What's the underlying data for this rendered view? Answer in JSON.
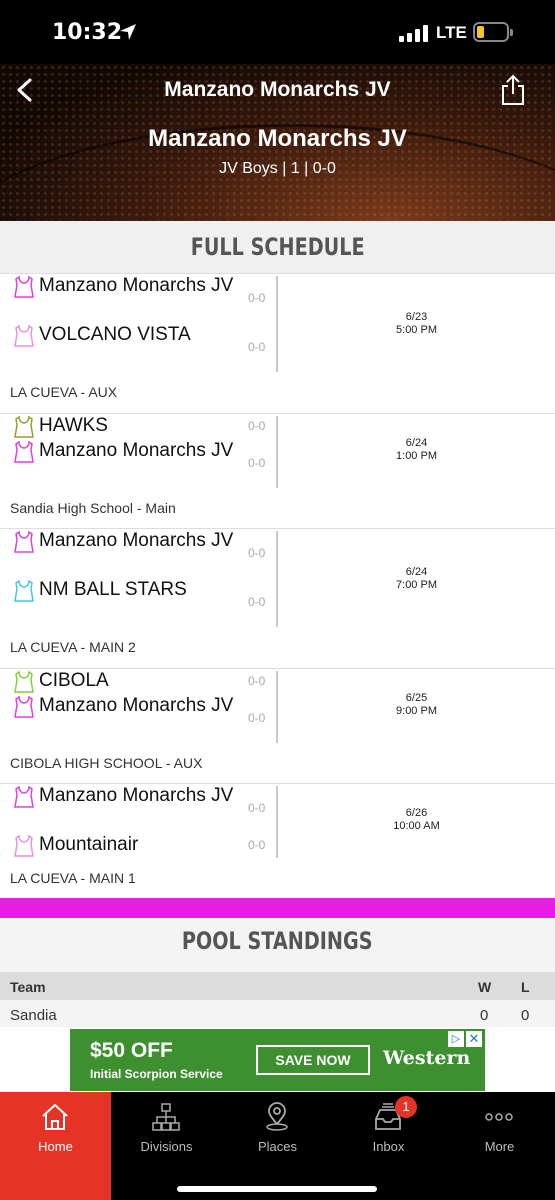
{
  "status": {
    "time": "10:32",
    "network": "LTE"
  },
  "nav": {
    "title": "Manzano Monarchs JV"
  },
  "team": {
    "name": "Manzano Monarchs JV",
    "subtitle": "JV Boys | 1 | 0-0"
  },
  "schedule": {
    "title": "FULL SCHEDULE",
    "games": [
      {
        "home": "Manzano Monarchs JV",
        "home_score": "0-0",
        "away": "VOLCANO VISTA",
        "away_score": "0-0",
        "date": "6/23",
        "time": "5:00 PM",
        "location": "LA CUEVA - AUX"
      },
      {
        "home": "HAWKS",
        "home_score": "0-0",
        "away": "Manzano Monarchs JV",
        "away_score": "0-0",
        "date": "6/24",
        "time": "1:00 PM",
        "location": "Sandia High School - Main"
      },
      {
        "home": "Manzano Monarchs JV",
        "home_score": "0-0",
        "away": "NM BALL STARS",
        "away_score": "0-0",
        "date": "6/24",
        "time": "7:00 PM",
        "location": "LA CUEVA - MAIN 2"
      },
      {
        "home": "CIBOLA",
        "home_score": "0-0",
        "away": "Manzano Monarchs JV",
        "away_score": "0-0",
        "date": "6/25",
        "time": "9:00 PM",
        "location": "CIBOLA HIGH SCHOOL - AUX"
      },
      {
        "home": "Manzano Monarchs JV",
        "home_score": "0-0",
        "away": "Mountainair",
        "away_score": "0-0",
        "date": "6/26",
        "time": "10:00 AM",
        "location": "LA CUEVA - MAIN 1"
      }
    ]
  },
  "standings": {
    "title": "POOL STANDINGS",
    "headers": {
      "team": "Team",
      "wins": "W",
      "losses": "L"
    },
    "rows": [
      {
        "team": "Sandia",
        "wins": "0",
        "losses": "0"
      }
    ]
  },
  "ad": {
    "headline": "$50 OFF",
    "subline": "Initial Scorpion Service",
    "cta": "SAVE NOW",
    "brand": "Western",
    "info": "▷",
    "close": "✕"
  },
  "tabs": [
    {
      "label": "Home",
      "icon": "home-icon",
      "active": true
    },
    {
      "label": "Divisions",
      "icon": "divisions-icon"
    },
    {
      "label": "Places",
      "icon": "location-pin-icon"
    },
    {
      "label": "Inbox",
      "icon": "inbox-icon",
      "badge": "1"
    },
    {
      "label": "More",
      "icon": "more-icon"
    }
  ],
  "colors": {
    "accent": "#e53425",
    "pool_bar": "#e61ee6",
    "jersey_pink": "#e040e0",
    "jersey_olive": "#9a9a30",
    "jersey_cyan": "#40c8d8",
    "jersey_green": "#80d040",
    "jersey_lightpink": "#e890e8"
  }
}
